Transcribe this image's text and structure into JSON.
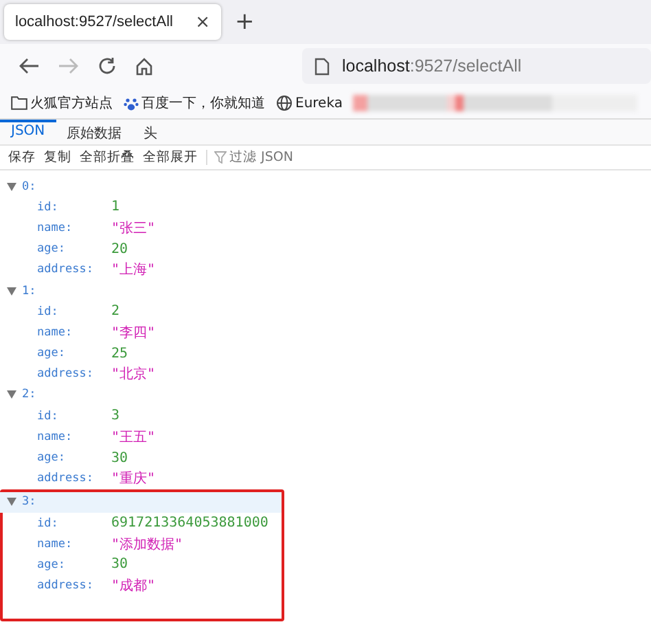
{
  "tab": {
    "title": "localhost:9527/selectAll",
    "close": "×"
  },
  "new_tab": "+",
  "address_bar": {
    "host": "localhost",
    "path": ":9527/selectAll"
  },
  "bookmarks": [
    {
      "kind": "folder",
      "label": "火狐官方站点"
    },
    {
      "kind": "paw",
      "label": "百度一下，你就知道"
    },
    {
      "kind": "globe",
      "label": "Eureka"
    },
    {
      "kind": "blurred"
    }
  ],
  "viewer_tabs": [
    {
      "label": "JSON",
      "selected": true
    },
    {
      "label": "原始数据",
      "selected": false
    },
    {
      "label": "头",
      "selected": false
    }
  ],
  "toolbar": {
    "buttons": [
      "保存",
      "复制",
      "全部折叠",
      "全部展开"
    ],
    "filter_placeholder": "过滤 JSON"
  },
  "records": [
    {
      "index": "0:",
      "expanded": true,
      "selected": false,
      "highlighted": false,
      "fields": [
        {
          "key": "id:",
          "value": "1",
          "kind": "number"
        },
        {
          "key": "name:",
          "value": "\"张三\"",
          "kind": "string"
        },
        {
          "key": "age:",
          "value": "20",
          "kind": "number"
        },
        {
          "key": "address:",
          "value": "\"上海\"",
          "kind": "string"
        }
      ]
    },
    {
      "index": "1:",
      "expanded": true,
      "selected": false,
      "highlighted": false,
      "fields": [
        {
          "key": "id:",
          "value": "2",
          "kind": "number"
        },
        {
          "key": "name:",
          "value": "\"李四\"",
          "kind": "string"
        },
        {
          "key": "age:",
          "value": "25",
          "kind": "number"
        },
        {
          "key": "address:",
          "value": "\"北京\"",
          "kind": "string"
        }
      ]
    },
    {
      "index": "2:",
      "expanded": true,
      "selected": false,
      "highlighted": false,
      "fields": [
        {
          "key": "id:",
          "value": "3",
          "kind": "number"
        },
        {
          "key": "name:",
          "value": "\"王五\"",
          "kind": "string"
        },
        {
          "key": "age:",
          "value": "30",
          "kind": "number"
        },
        {
          "key": "address:",
          "value": "\"重庆\"",
          "kind": "string"
        }
      ]
    },
    {
      "index": "3:",
      "expanded": true,
      "selected": true,
      "highlighted": true,
      "fields": [
        {
          "key": "id:",
          "value": "6917213364053881000",
          "kind": "number"
        },
        {
          "key": "name:",
          "value": "\"添加数据\"",
          "kind": "string"
        },
        {
          "key": "age:",
          "value": "30",
          "kind": "number"
        },
        {
          "key": "address:",
          "value": "\"成都\"",
          "kind": "string"
        }
      ]
    }
  ]
}
